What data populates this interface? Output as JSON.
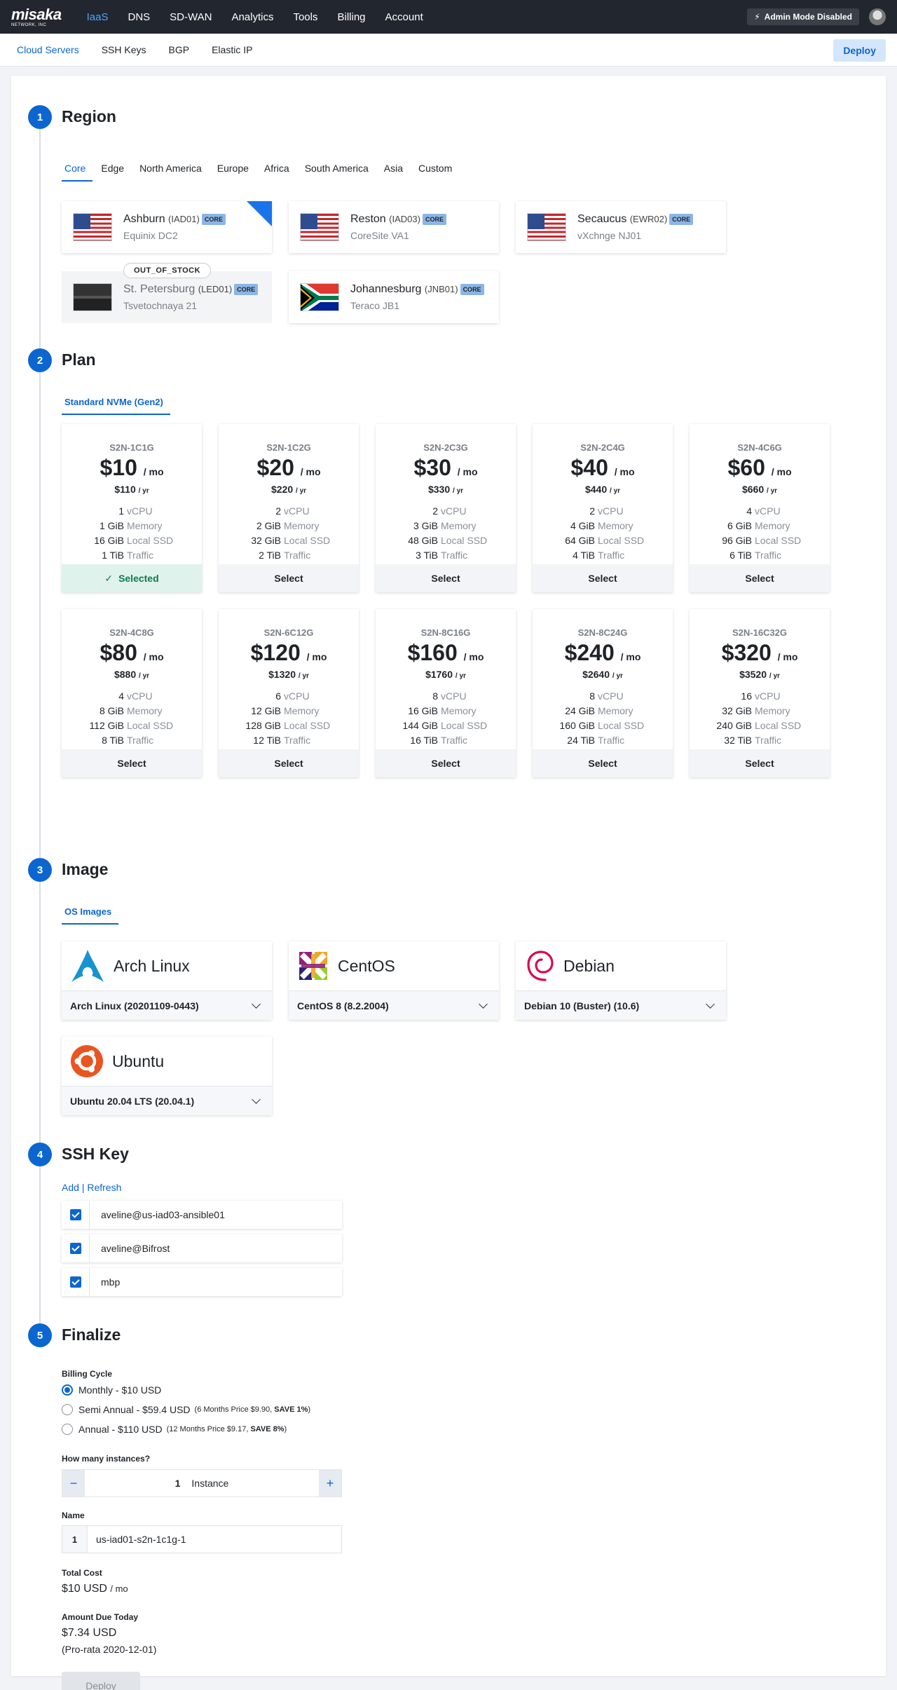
{
  "topbar": {
    "logo": "misaka",
    "logo_sub": "NETWORK, INC",
    "nav": [
      "IaaS",
      "DNS",
      "SD-WAN",
      "Analytics",
      "Tools",
      "Billing",
      "Account"
    ],
    "admin": "Admin Mode Disabled"
  },
  "subnav": {
    "items": [
      "Cloud Servers",
      "SSH Keys",
      "BGP",
      "Elastic IP"
    ],
    "deploy": "Deploy"
  },
  "region": {
    "step": "1",
    "title": "Region",
    "tabs": [
      "Core",
      "Edge",
      "North America",
      "Europe",
      "Africa",
      "South America",
      "Asia",
      "Custom"
    ],
    "badge": "CORE",
    "oos": "OUT_OF_STOCK",
    "items": [
      {
        "name": "Ashburn",
        "code": "(IAD01)",
        "site": "Equinix DC2"
      },
      {
        "name": "Reston",
        "code": "(IAD03)",
        "site": "CoreSite VA1"
      },
      {
        "name": "Secaucus",
        "code": "(EWR02)",
        "site": "vXchnge NJ01"
      },
      {
        "name": "St. Petersburg",
        "code": "(LED01)",
        "site": "Tsvetochnaya 21"
      },
      {
        "name": "Johannesburg",
        "code": "(JNB01)",
        "site": "Teraco JB1"
      }
    ]
  },
  "plan": {
    "step": "2",
    "title": "Plan",
    "tab": "Standard NVMe (Gen2)",
    "mo": "/ mo",
    "yr": "/ yr",
    "labels": {
      "cpu": "vCPU",
      "mem": "Memory",
      "ssd": "Local SSD",
      "traffic": "Traffic"
    },
    "selected": "Selected",
    "select": "Select",
    "items": [
      {
        "name": "S2N-1C1G",
        "price": "$10",
        "year": "$110",
        "cpu": "1",
        "mem": "1 GiB",
        "ssd": "16 GiB",
        "traffic": "1 TiB"
      },
      {
        "name": "S2N-1C2G",
        "price": "$20",
        "year": "$220",
        "cpu": "2",
        "mem": "2 GiB",
        "ssd": "32 GiB",
        "traffic": "2 TiB"
      },
      {
        "name": "S2N-2C3G",
        "price": "$30",
        "year": "$330",
        "cpu": "2",
        "mem": "3 GiB",
        "ssd": "48 GiB",
        "traffic": "3 TiB"
      },
      {
        "name": "S2N-2C4G",
        "price": "$40",
        "year": "$440",
        "cpu": "2",
        "mem": "4 GiB",
        "ssd": "64 GiB",
        "traffic": "4 TiB"
      },
      {
        "name": "S2N-4C6G",
        "price": "$60",
        "year": "$660",
        "cpu": "4",
        "mem": "6 GiB",
        "ssd": "96 GiB",
        "traffic": "6 TiB"
      },
      {
        "name": "S2N-4C8G",
        "price": "$80",
        "year": "$880",
        "cpu": "4",
        "mem": "8 GiB",
        "ssd": "112 GiB",
        "traffic": "8 TiB"
      },
      {
        "name": "S2N-6C12G",
        "price": "$120",
        "year": "$1320",
        "cpu": "6",
        "mem": "12 GiB",
        "ssd": "128 GiB",
        "traffic": "12 TiB"
      },
      {
        "name": "S2N-8C16G",
        "price": "$160",
        "year": "$1760",
        "cpu": "8",
        "mem": "16 GiB",
        "ssd": "144 GiB",
        "traffic": "16 TiB"
      },
      {
        "name": "S2N-8C24G",
        "price": "$240",
        "year": "$2640",
        "cpu": "8",
        "mem": "24 GiB",
        "ssd": "160 GiB",
        "traffic": "24 TiB"
      },
      {
        "name": "S2N-16C32G",
        "price": "$320",
        "year": "$3520",
        "cpu": "16",
        "mem": "32 GiB",
        "ssd": "240 GiB",
        "traffic": "32 TiB"
      }
    ]
  },
  "image": {
    "step": "3",
    "title": "Image",
    "tab": "OS Images",
    "items": [
      {
        "name": "Arch Linux",
        "version": "Arch Linux (20201109-0443)"
      },
      {
        "name": "CentOS",
        "version": "CentOS 8 (8.2.2004)"
      },
      {
        "name": "Debian",
        "version": "Debian 10 (Buster) (10.6)"
      },
      {
        "name": "Ubuntu",
        "version": "Ubuntu 20.04 LTS (20.04.1)"
      }
    ]
  },
  "ssh": {
    "step": "4",
    "title": "SSH Key",
    "add": "Add",
    "sep": "|",
    "refresh": "Refresh",
    "keys": [
      "aveline@us-iad03-ansible01",
      "aveline@Bifrost",
      "mbp"
    ]
  },
  "finalize": {
    "step": "5",
    "title": "Finalize",
    "billing_label": "Billing Cycle",
    "monthly": "Monthly - $10 USD",
    "semi": "Semi Annual - $59.4 USD",
    "semi_note_a": "(6 Months Price $9.90, ",
    "semi_note_b": "SAVE 1%",
    "semi_note_c": ")",
    "annual": "Annual - $110 USD",
    "annual_note_a": "(12 Months Price $9.17, ",
    "annual_note_b": "SAVE 8%",
    "annual_note_c": ")",
    "instances_label": "How many instances?",
    "instances_value": "1",
    "instances_unit": "Instance",
    "minus": "−",
    "plus": "+",
    "name_label": "Name",
    "name_index": "1",
    "name_value": "us-iad01-s2n-1c1g-1",
    "total_label": "Total Cost",
    "total_value": "$10 USD",
    "total_unit": "/ mo",
    "due_label": "Amount Due Today",
    "due_value": "$7.34 USD",
    "due_note": "(Pro-rata 2020-12-01)",
    "deploy": "Deploy"
  }
}
